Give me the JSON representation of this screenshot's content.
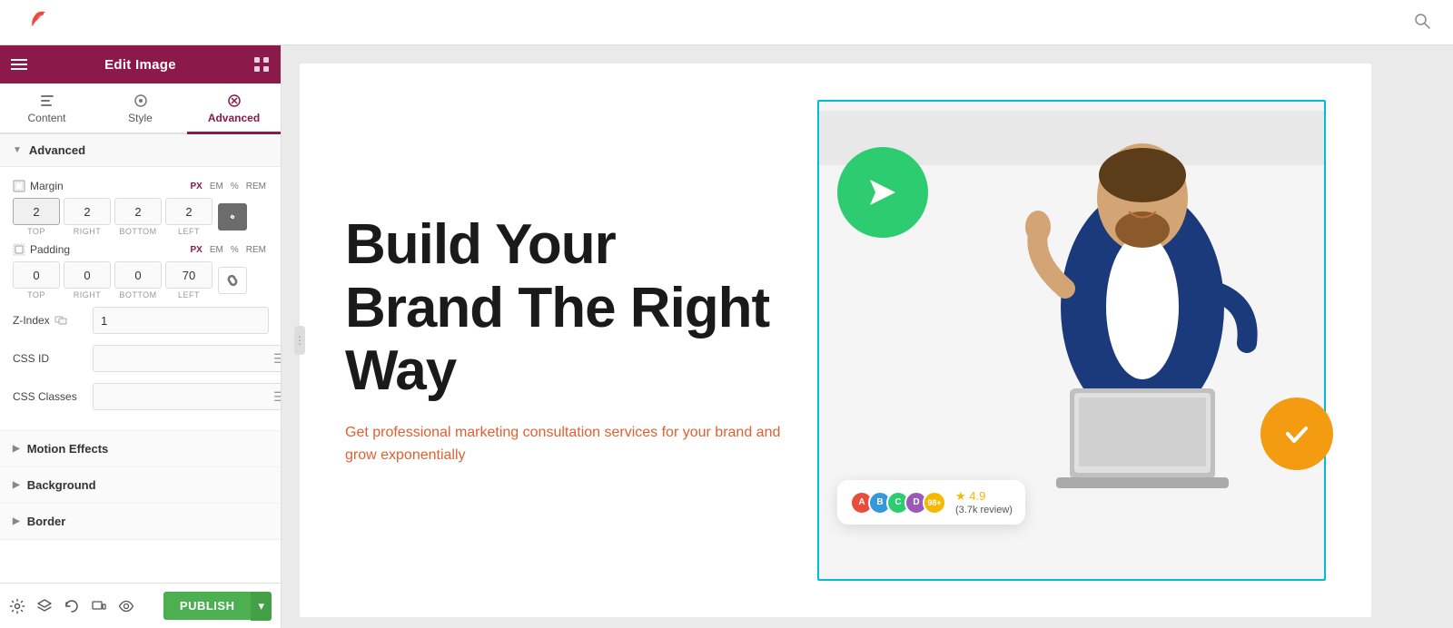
{
  "header": {
    "title": "Edit Image",
    "publish_label": "PUBLISH"
  },
  "tabs": [
    {
      "id": "content",
      "label": "Content"
    },
    {
      "id": "style",
      "label": "Style"
    },
    {
      "id": "advanced",
      "label": "Advanced"
    }
  ],
  "active_tab": "advanced",
  "sections": {
    "advanced": {
      "label": "Advanced",
      "margin": {
        "label": "Margin",
        "units": [
          "PX",
          "EM",
          "%",
          "REM"
        ],
        "active_unit": "PX",
        "top": "2",
        "right": "2",
        "bottom": "2",
        "left": "2"
      },
      "padding": {
        "label": "Padding",
        "units": [
          "PX",
          "EM",
          "%",
          "REM"
        ],
        "active_unit": "PX",
        "top": "0",
        "right": "0",
        "bottom": "0",
        "left": "70"
      },
      "z_index": {
        "label": "Z-Index",
        "value": "1"
      },
      "css_id": {
        "label": "CSS ID",
        "value": "",
        "placeholder": ""
      },
      "css_classes": {
        "label": "CSS Classes",
        "value": "",
        "placeholder": ""
      }
    }
  },
  "collapsed_sections": [
    {
      "id": "motion-effects",
      "label": "Motion Effects"
    },
    {
      "id": "background",
      "label": "Background"
    },
    {
      "id": "border",
      "label": "Border"
    }
  ],
  "canvas": {
    "heading": "Build Your Brand The Right Way",
    "subtext": "Get professional marketing consultation services for your brand and grow exponentially",
    "review_score": "4.9",
    "review_count": "(3.7k review)",
    "avatar_plus": "98+"
  },
  "bottom_toolbar": {
    "icons": [
      "settings",
      "layers",
      "history",
      "responsive",
      "eye"
    ],
    "publish_label": "PUBLISH"
  }
}
